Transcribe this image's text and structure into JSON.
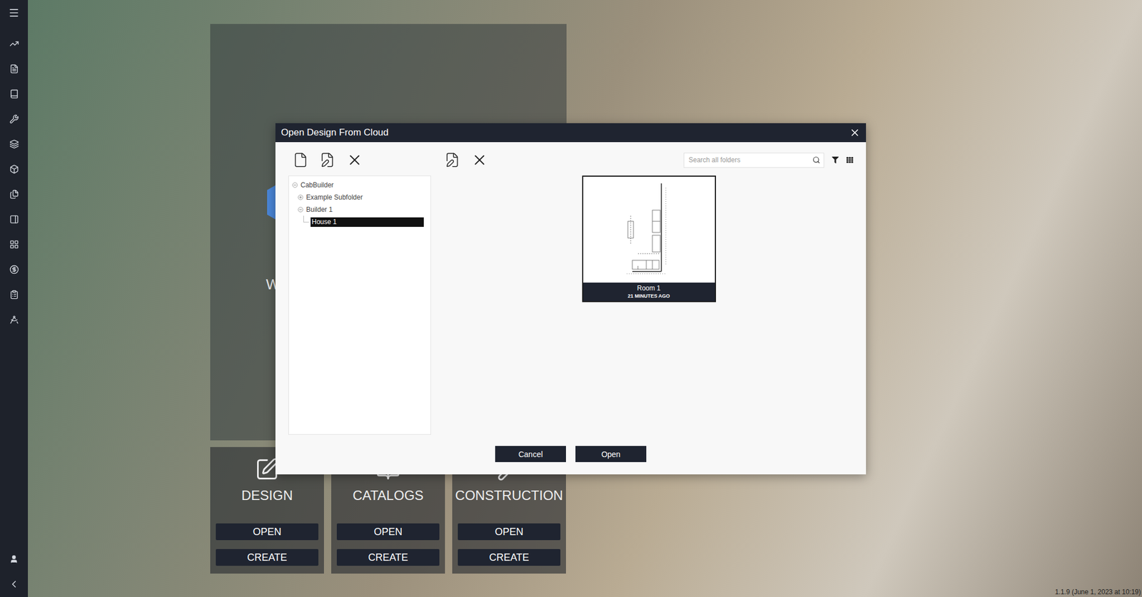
{
  "window": {
    "title": "Open Design From Cloud"
  },
  "home": {
    "welcome_fragment": "W",
    "cards": [
      {
        "label": "DESIGN",
        "buttons": [
          "OPEN",
          "CREATE"
        ]
      },
      {
        "label": "CATALOGS",
        "buttons": [
          "OPEN",
          "CREATE"
        ]
      },
      {
        "label": "CONSTRUCTION",
        "buttons": [
          "OPEN",
          "CREATE"
        ]
      }
    ]
  },
  "search": {
    "placeholder": "Search all folders"
  },
  "tree": [
    {
      "label": "CabBuilder",
      "depth": 0,
      "kind": "branch",
      "expanded": true,
      "selected": false
    },
    {
      "label": "Example Subfolder",
      "depth": 1,
      "kind": "branch",
      "expanded": false,
      "selected": false
    },
    {
      "label": "Builder 1",
      "depth": 1,
      "kind": "branch",
      "expanded": true,
      "selected": false
    },
    {
      "label": "House 1",
      "depth": 2,
      "kind": "leaf",
      "expanded": false,
      "selected": true
    }
  ],
  "designs": [
    {
      "name": "Room 1",
      "modified": "21 MINUTES AGO"
    }
  ],
  "buttons": [
    "Cancel",
    "Open"
  ],
  "status_bar": {
    "version": "1.1.9 (June 1, 2023 at 10:19)"
  }
}
